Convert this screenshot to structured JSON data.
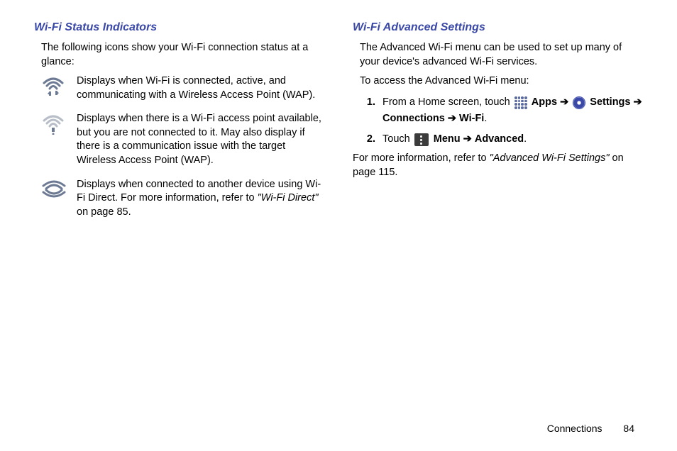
{
  "left": {
    "title": "Wi-Fi Status Indicators",
    "intro": "The following icons show your Wi-Fi connection status at a glance:",
    "items": [
      {
        "desc": "Displays when Wi-Fi is connected, active, and communicating with a Wireless Access Point (WAP)."
      },
      {
        "desc": "Displays when there is a Wi-Fi access point available, but you are not connected to it. May also display if there is a communication issue with the target Wireless Access Point (WAP)."
      },
      {
        "desc_pre": "Displays when connected to another device using Wi-Fi Direct. For more information, refer to ",
        "desc_ref": "\"Wi-Fi Direct\"",
        "desc_post": "  on page 85."
      }
    ]
  },
  "right": {
    "title": "Wi-Fi Advanced Settings",
    "intro1": "The Advanced Wi-Fi menu can be used to set up many of your device's advanced Wi-Fi services.",
    "intro2": "To access the Advanced Wi-Fi menu:",
    "steps": [
      {
        "num": "1.",
        "pre": "From a Home screen, touch",
        "apps": "Apps",
        "arrow1": "➔",
        "settings": "Settings",
        "arrow2": "➔",
        "connections": "Connections",
        "arrow3": "➔",
        "wifi": "Wi-Fi",
        "dot": "."
      },
      {
        "num": "2.",
        "pre": "Touch",
        "menu": "Menu",
        "arrow": "➔",
        "advanced": "Advanced",
        "dot": "."
      }
    ],
    "more_pre": "For more information, refer to ",
    "more_ref": "\"Advanced Wi-Fi Settings\"",
    "more_post": "  on page 115."
  },
  "footer": {
    "section": "Connections",
    "page": "84"
  }
}
